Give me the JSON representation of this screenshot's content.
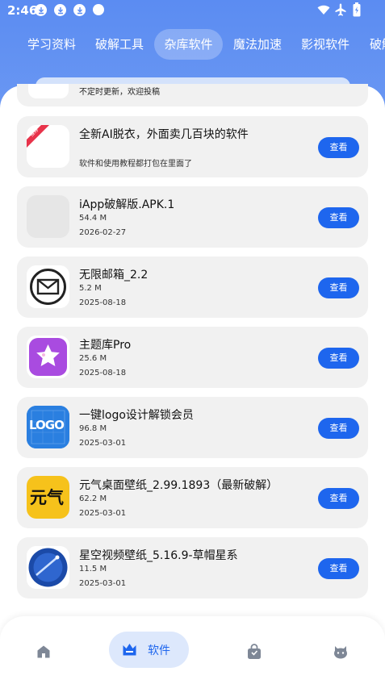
{
  "status": {
    "time": "2:46"
  },
  "tabs": [
    {
      "label": "学习资料",
      "active": false
    },
    {
      "label": "破解工具",
      "active": false
    },
    {
      "label": "杂库软件",
      "active": true
    },
    {
      "label": "魔法加速",
      "active": false
    },
    {
      "label": "影视软件",
      "active": false
    },
    {
      "label": "破解",
      "active": false
    }
  ],
  "partial_card": {
    "text": "不定时更新，欢迎投稿"
  },
  "apps": [
    {
      "title": "全新AI脱衣，外面卖几百块的软件",
      "line1": "",
      "line2": "",
      "desc": "软件和使用教程都打包在里面了",
      "icon": "ai-app-icon",
      "badge": "推荐",
      "button": "查看"
    },
    {
      "title": "iApp破解版.APK.1",
      "line1": "54.4 M",
      "line2": "2026-02-27",
      "icon": "placeholder-icon",
      "button": "查看"
    },
    {
      "title": "无限邮箱_2.2",
      "line1": "5.2 M",
      "line2": "2025-08-18",
      "icon": "mail-icon",
      "button": "查看"
    },
    {
      "title": "主题库Pro",
      "line1": "25.6 M",
      "line2": "2025-08-18",
      "icon": "theme-star-icon",
      "button": "查看"
    },
    {
      "title": "一键logo设计解锁会员",
      "line1": "96.8 M",
      "line2": "2025-03-01",
      "icon": "logo-design-icon",
      "icon_text": "LOGO",
      "button": "查看"
    },
    {
      "title": "元气桌面壁纸_2.99.1893（最新破解）",
      "line1": "62.2 M",
      "line2": "2025-03-01",
      "icon": "yuanqi-icon",
      "icon_text": "元气",
      "button": "查看"
    },
    {
      "title": "星空视频壁纸_5.16.9-草帽星系",
      "line1": "11.5 M",
      "line2": "2025-03-01",
      "icon": "starry-sky-icon",
      "button": "查看"
    }
  ],
  "bottom_nav": [
    {
      "label": "",
      "icon": "home-icon",
      "active": false
    },
    {
      "label": "软件",
      "icon": "software-crown-icon",
      "active": true
    },
    {
      "label": "",
      "icon": "shop-bag-icon",
      "active": false
    },
    {
      "label": "",
      "icon": "profile-face-icon",
      "active": false
    }
  ],
  "colors": {
    "header": "#5b8cf2",
    "accent": "#1e66ee",
    "card": "#f1f1f1"
  }
}
